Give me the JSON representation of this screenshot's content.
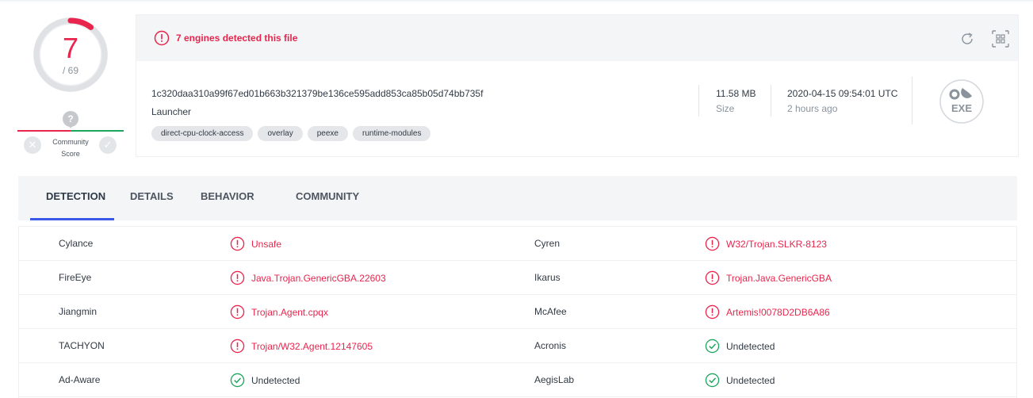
{
  "score": {
    "detected": "7",
    "total": "/ 69",
    "detected_fraction": 0.1014,
    "colors": {
      "detected": "#e8254d",
      "ring": "#dfe1e4"
    }
  },
  "community": {
    "label_line1": "Community",
    "label_line2": "Score",
    "question_mark": "?",
    "vote_down_glyph": "✕",
    "vote_up_glyph": "✓",
    "colors": {
      "negative": "#e8254d",
      "positive": "#1ba55d"
    }
  },
  "alert": {
    "text": "7 engines detected this file",
    "icons": {
      "alert": "alert-circle-icon",
      "reanalyze": "reanalyze-icon",
      "similar": "similar-files-icon"
    }
  },
  "file": {
    "hash": "1c320daa310a99f67ed01b663b321379be136ce595add853ca85b05d74bb735f",
    "name": "Launcher",
    "tags": [
      "direct-cpu-clock-access",
      "overlay",
      "peexe",
      "runtime-modules"
    ],
    "size_value": "11.58 MB",
    "size_label": "Size",
    "date_value": "2020-04-15 09:54:01 UTC",
    "date_label": "2 hours ago",
    "type_badge": "EXE"
  },
  "tabs": [
    {
      "label": "DETECTION",
      "active": true
    },
    {
      "label": "DETAILS",
      "active": false
    },
    {
      "label": "BEHAVIOR",
      "active": false
    },
    {
      "label": "COMMUNITY",
      "active": false
    }
  ],
  "detections": [
    {
      "left": {
        "engine": "Cylance",
        "result": "Unsafe",
        "status": "malicious"
      },
      "right": {
        "engine": "Cyren",
        "result": "W32/Trojan.SLKR-8123",
        "status": "malicious"
      }
    },
    {
      "left": {
        "engine": "FireEye",
        "result": "Java.Trojan.GenericGBA.22603",
        "status": "malicious"
      },
      "right": {
        "engine": "Ikarus",
        "result": "Trojan.Java.GenericGBA",
        "status": "malicious"
      }
    },
    {
      "left": {
        "engine": "Jiangmin",
        "result": "Trojan.Agent.cpqx",
        "status": "malicious"
      },
      "right": {
        "engine": "McAfee",
        "result": "Artemis!0078D2DB6A86",
        "status": "malicious"
      }
    },
    {
      "left": {
        "engine": "TACHYON",
        "result": "Trojan/W32.Agent.12147605",
        "status": "malicious"
      },
      "right": {
        "engine": "Acronis",
        "result": "Undetected",
        "status": "undetected"
      }
    },
    {
      "left": {
        "engine": "Ad-Aware",
        "result": "Undetected",
        "status": "undetected"
      },
      "right": {
        "engine": "AegisLab",
        "result": "Undetected",
        "status": "undetected"
      }
    }
  ],
  "status_colors": {
    "malicious": "#e8254d",
    "undetected": "#1ba55d"
  }
}
